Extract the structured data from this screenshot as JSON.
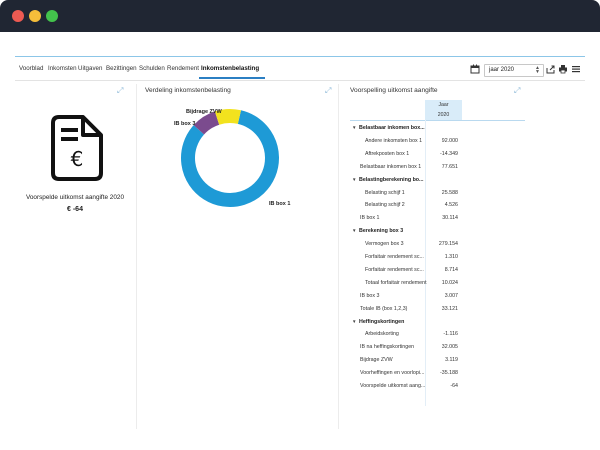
{
  "window": {
    "dots": [
      {
        "name": "close",
        "color": "#ed5a52"
      },
      {
        "name": "minimize",
        "color": "#f5bd3a"
      },
      {
        "name": "maximize",
        "color": "#43c24c"
      }
    ]
  },
  "nav": {
    "tabs": [
      {
        "label": "Voorblad"
      },
      {
        "label": "Inkomsten"
      },
      {
        "label": "Uitgaven"
      },
      {
        "label": "Bezittingen"
      },
      {
        "label": "Schulden"
      },
      {
        "label": "Rendement"
      },
      {
        "label": "Inkomstenbelasting",
        "active": true
      }
    ],
    "year_select": "jaar 2020"
  },
  "left_panel": {
    "label": "Voorspelde uitkomst aangifte  2020",
    "value": "€ -64",
    "icon": "euro-document-icon"
  },
  "middle_panel": {
    "title": "Verdeling inkomstenbelasting"
  },
  "chart_data": {
    "type": "pie",
    "donut": true,
    "labels": [
      "IB box 1",
      "IB box 3",
      "Bijdrage ZVW"
    ],
    "values": [
      30.114,
      3.007,
      3.119
    ],
    "colors": [
      "#1e9ad6",
      "#7b4b8e",
      "#f2e21e"
    ]
  },
  "right_panel": {
    "title": "Voorspelling uitkomst aangifte",
    "column_header": "Jaar",
    "column_year": "2020",
    "rows": [
      {
        "label": "Belastbaar inkomen box...",
        "value": "",
        "level": 0,
        "group": true
      },
      {
        "label": "Andere inkomsten box 1",
        "value": "92.000",
        "level": 2
      },
      {
        "label": "Aftrekposten box 1",
        "value": "-14.349",
        "level": 2
      },
      {
        "label": "Belastbaar inkomen box 1",
        "value": "77.651",
        "level": 1
      },
      {
        "label": "Belastingberekening bo...",
        "value": "",
        "level": 0,
        "group": true
      },
      {
        "label": "Belasting schijf 1",
        "value": "25.588",
        "level": 2
      },
      {
        "label": "Belasting schijf 2",
        "value": "4.526",
        "level": 2
      },
      {
        "label": "IB box 1",
        "value": "30.114",
        "level": 1
      },
      {
        "label": "Berekening box 3",
        "value": "",
        "level": 0,
        "group": true
      },
      {
        "label": "Vermogen box 3",
        "value": "279.154",
        "level": 2
      },
      {
        "label": "Forfaitair rendement sc...",
        "value": "1.310",
        "level": 2
      },
      {
        "label": "Forfaitair rendement sc...",
        "value": "8.714",
        "level": 2
      },
      {
        "label": "Totaal forfaitair rendement",
        "value": "10.024",
        "level": 2
      },
      {
        "label": "IB box 3",
        "value": "3.007",
        "level": 1
      },
      {
        "label": "Totale IB (box 1,2,3)",
        "value": "33.121",
        "level": 1
      },
      {
        "label": "Heffingskortingen",
        "value": "",
        "level": 0,
        "group": true
      },
      {
        "label": "Arbeidskorting",
        "value": "-1.116",
        "level": 2
      },
      {
        "label": "IB na heffingskortingen",
        "value": "32.005",
        "level": 1
      },
      {
        "label": "Bijdrage ZVW",
        "value": "3.119",
        "level": 1
      },
      {
        "label": "Voorheffingen en voorlopi...",
        "value": "-35.188",
        "level": 1
      },
      {
        "label": "Voorspelde uitkomst aang...",
        "value": "-64",
        "level": 1
      }
    ]
  }
}
